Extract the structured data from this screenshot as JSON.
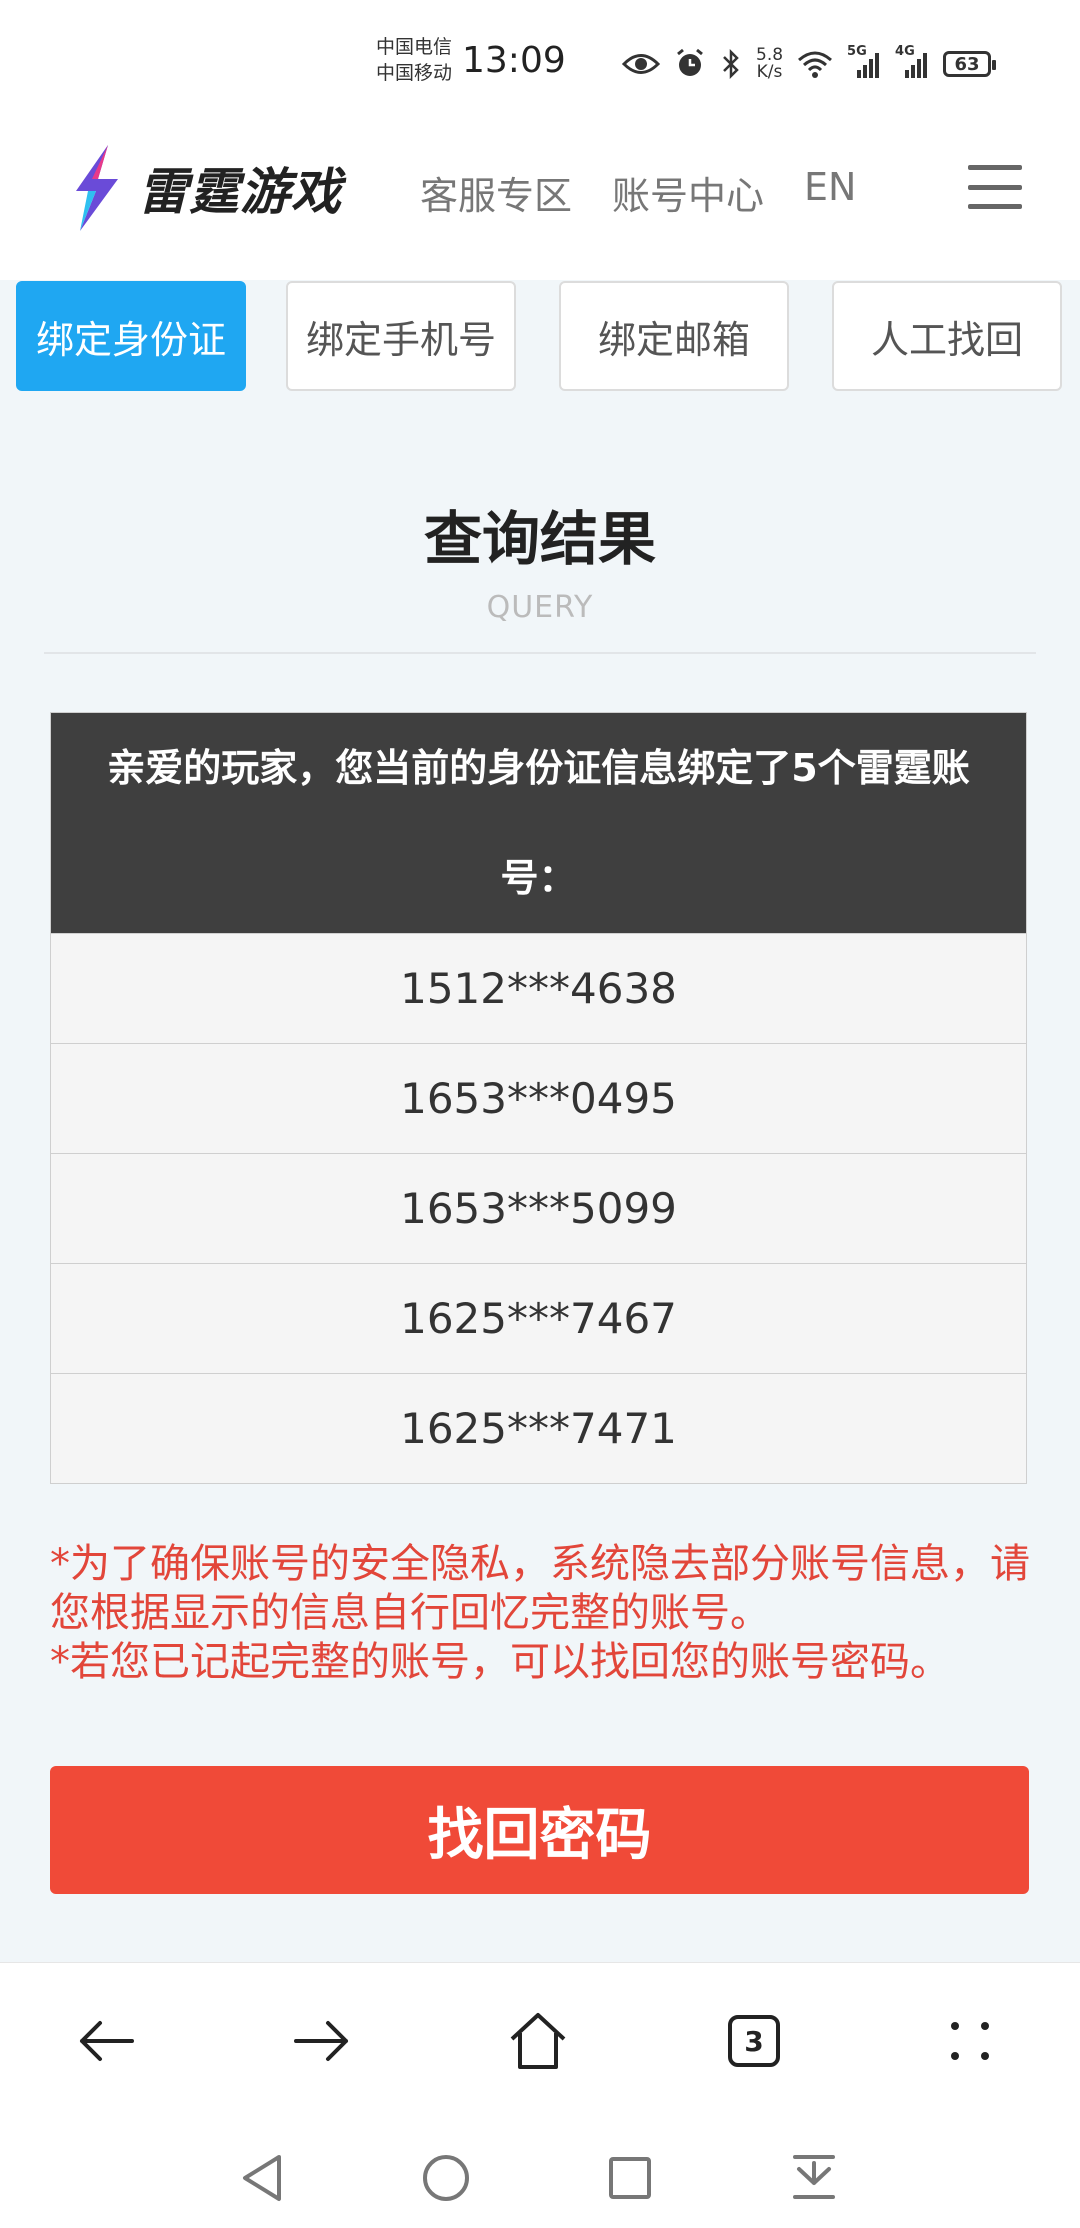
{
  "status_bar": {
    "carrier_1": "中国电信",
    "carrier_2": "中国移动",
    "time": "13:09",
    "net_speed_value": "5.8",
    "net_speed_unit": "K/s",
    "net_5g": "5G",
    "net_4g": "4G",
    "battery": "63"
  },
  "header": {
    "logo_text": "雷霆游戏",
    "nav": [
      "客服专区",
      "账号中心",
      "EN"
    ]
  },
  "tabs": [
    {
      "label": "绑定身份证",
      "active": true
    },
    {
      "label": "绑定手机号",
      "active": false
    },
    {
      "label": "绑定邮箱",
      "active": false
    },
    {
      "label": "人工找回",
      "active": false
    }
  ],
  "result": {
    "title": "查询结果",
    "subtitle": "QUERY",
    "table_header": "亲爱的玩家，您当前的身份证信息绑定了5个雷霆账号：",
    "accounts": [
      "1512***4638",
      "1653***0495",
      "1653***5099",
      "1625***7467",
      "1625***7471"
    ]
  },
  "notes": [
    "*为了确保账号的安全隐私，系统隐去部分账号信息，请您根据显示的信息自行回忆完整的账号。",
    "*若您已记起完整的账号，可以找回您的账号密码。"
  ],
  "button": {
    "label": "找回密码"
  },
  "browser_bar": {
    "tab_count": "3"
  },
  "colors": {
    "tab_active": "#1fa7f2",
    "table_header_bg": "#3f3f3f",
    "note_text": "#e2463a",
    "button_bg": "#f04a38",
    "page_bg": "#f1f6f9"
  },
  "icons": [
    "eye-icon",
    "alarm-icon",
    "bluetooth-icon",
    "wifi-icon",
    "signal-icon",
    "battery-icon",
    "menu-icon",
    "back-arrow-icon",
    "forward-arrow-icon",
    "home-icon",
    "tabs-icon",
    "more-icon",
    "nav-back-icon",
    "nav-home-icon",
    "nav-recents-icon",
    "nav-download-icon"
  ]
}
